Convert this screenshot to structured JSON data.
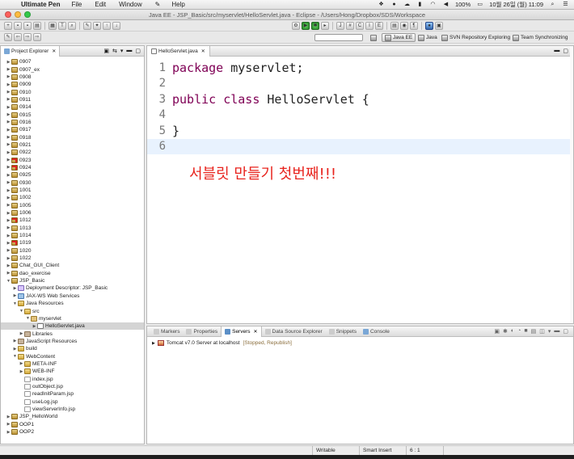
{
  "menubar": {
    "app": "Ultimate Pen",
    "menus": [
      "File",
      "Edit",
      "Window",
      "Help"
    ],
    "battery": "100%",
    "datetime": "10월 26일 (월)  11:09"
  },
  "window": {
    "title": "Java EE - JSP_Basic/src/myservlet/HelloServlet.java - Eclipse - /Users/Hong/Dropbox/SDS/Workspace"
  },
  "perspectives": {
    "java_ee": "Java EE",
    "java": "Java",
    "svn": "SVN Repository Exploring",
    "team": "Team Synchronizing"
  },
  "explorer": {
    "title": "Project Explorer",
    "rows": [
      {
        "label": "0907",
        "depth": 0,
        "arrow": "▶",
        "icon": "proj"
      },
      {
        "label": "0907_ex",
        "depth": 0,
        "arrow": "▶",
        "icon": "proj"
      },
      {
        "label": "0908",
        "depth": 0,
        "arrow": "▶",
        "icon": "proj"
      },
      {
        "label": "0909",
        "depth": 0,
        "arrow": "▶",
        "icon": "proj"
      },
      {
        "label": "0910",
        "depth": 0,
        "arrow": "▶",
        "icon": "proj"
      },
      {
        "label": "0911",
        "depth": 0,
        "arrow": "▶",
        "icon": "proj"
      },
      {
        "label": "0914",
        "depth": 0,
        "arrow": "▶",
        "icon": "proj"
      },
      {
        "label": "0915",
        "depth": 0,
        "arrow": "▶",
        "icon": "proj"
      },
      {
        "label": "0916",
        "depth": 0,
        "arrow": "▶",
        "icon": "proj"
      },
      {
        "label": "0917",
        "depth": 0,
        "arrow": "▶",
        "icon": "proj"
      },
      {
        "label": "0918",
        "depth": 0,
        "arrow": "▶",
        "icon": "proj"
      },
      {
        "label": "0921",
        "depth": 0,
        "arrow": "▶",
        "icon": "proj"
      },
      {
        "label": "0922",
        "depth": 0,
        "arrow": "▶",
        "icon": "proj"
      },
      {
        "label": "0923",
        "depth": 0,
        "arrow": "▶",
        "icon": "proj err"
      },
      {
        "label": "0924",
        "depth": 0,
        "arrow": "▶",
        "icon": "proj err"
      },
      {
        "label": "0925",
        "depth": 0,
        "arrow": "▶",
        "icon": "proj"
      },
      {
        "label": "0930",
        "depth": 0,
        "arrow": "▶",
        "icon": "proj"
      },
      {
        "label": "1001",
        "depth": 0,
        "arrow": "▶",
        "icon": "proj"
      },
      {
        "label": "1002",
        "depth": 0,
        "arrow": "▶",
        "icon": "proj"
      },
      {
        "label": "1005",
        "depth": 0,
        "arrow": "▶",
        "icon": "proj"
      },
      {
        "label": "1006",
        "depth": 0,
        "arrow": "▶",
        "icon": "proj"
      },
      {
        "label": "1012",
        "depth": 0,
        "arrow": "▶",
        "icon": "proj err"
      },
      {
        "label": "1013",
        "depth": 0,
        "arrow": "▶",
        "icon": "proj"
      },
      {
        "label": "1014",
        "depth": 0,
        "arrow": "▶",
        "icon": "proj"
      },
      {
        "label": "1019",
        "depth": 0,
        "arrow": "▶",
        "icon": "proj err"
      },
      {
        "label": "1020",
        "depth": 0,
        "arrow": "▶",
        "icon": "proj"
      },
      {
        "label": "1022",
        "depth": 0,
        "arrow": "▶",
        "icon": "proj"
      },
      {
        "label": "Chat_GUI_Client",
        "depth": 0,
        "arrow": "▶",
        "icon": "proj"
      },
      {
        "label": "dao_exercise",
        "depth": 0,
        "arrow": "▶",
        "icon": "proj"
      },
      {
        "label": "JSP_Basic",
        "depth": 0,
        "arrow": "▼",
        "icon": "proj"
      },
      {
        "label": "Deployment Descriptor: JSP_Basic",
        "depth": 1,
        "arrow": "▶",
        "icon": "dd"
      },
      {
        "label": "JAX-WS Web Services",
        "depth": 1,
        "arrow": "▶",
        "icon": "ws"
      },
      {
        "label": "Java Resources",
        "depth": 1,
        "arrow": "▼",
        "icon": "folder"
      },
      {
        "label": "src",
        "depth": 2,
        "arrow": "▼",
        "icon": "folder"
      },
      {
        "label": "myservlet",
        "depth": 3,
        "arrow": "▼",
        "icon": "pkg"
      },
      {
        "label": "HelloServlet.java",
        "depth": 4,
        "arrow": "▶",
        "icon": "java",
        "selected": true
      },
      {
        "label": "Libraries",
        "depth": 2,
        "arrow": "▶",
        "icon": "jar"
      },
      {
        "label": "JavaScript Resources",
        "depth": 1,
        "arrow": "▶",
        "icon": "jar"
      },
      {
        "label": "build",
        "depth": 1,
        "arrow": "▶",
        "icon": "folder"
      },
      {
        "label": "WebContent",
        "depth": 1,
        "arrow": "▼",
        "icon": "folder"
      },
      {
        "label": "META-INF",
        "depth": 2,
        "arrow": "▶",
        "icon": "folder"
      },
      {
        "label": "WEB-INF",
        "depth": 2,
        "arrow": "▶",
        "icon": "folder"
      },
      {
        "label": "index.jsp",
        "depth": 2,
        "arrow": "",
        "icon": "file"
      },
      {
        "label": "outObject.jsp",
        "depth": 2,
        "arrow": "",
        "icon": "file"
      },
      {
        "label": "readInitParam.jsp",
        "depth": 2,
        "arrow": "",
        "icon": "file"
      },
      {
        "label": "useLog.jsp",
        "depth": 2,
        "arrow": "",
        "icon": "file"
      },
      {
        "label": "viewServerInfo.jsp",
        "depth": 2,
        "arrow": "",
        "icon": "file"
      },
      {
        "label": "JSP_HelloWorld",
        "depth": 0,
        "arrow": "▶",
        "icon": "proj"
      },
      {
        "label": "OOP1",
        "depth": 0,
        "arrow": "▶",
        "icon": "proj"
      },
      {
        "label": "OOP2",
        "depth": 0,
        "arrow": "▶",
        "icon": "proj"
      }
    ]
  },
  "editor": {
    "tab": "HelloServlet.java",
    "lines": [
      {
        "n": "1",
        "kw": "package",
        "rest": " myservlet;"
      },
      {
        "n": "2",
        "kw": "",
        "rest": ""
      },
      {
        "n": "3",
        "kw": "public class",
        "rest": " HelloServlet {"
      },
      {
        "n": "4",
        "kw": "",
        "rest": ""
      },
      {
        "n": "5",
        "kw": "",
        "rest": "}"
      },
      {
        "n": "6",
        "kw": "",
        "rest": "",
        "current": true
      }
    ],
    "annotation": "서블릿 만들기 첫번째!!!"
  },
  "bottom": {
    "tabs": [
      "Markers",
      "Properties",
      "Servers",
      "Data Source Explorer",
      "Snippets",
      "Console"
    ],
    "active_tab": "Servers",
    "server_name": "Tomcat v7.0 Server at localhost",
    "server_state": "[Stopped, Republish]"
  },
  "status": {
    "writable": "Writable",
    "insert_mode": "Smart Insert",
    "position": "6 : 1"
  },
  "colors": {
    "annotation": "#e8241e",
    "keyword": "#7f0055",
    "current_line": "#e8f2fe"
  }
}
